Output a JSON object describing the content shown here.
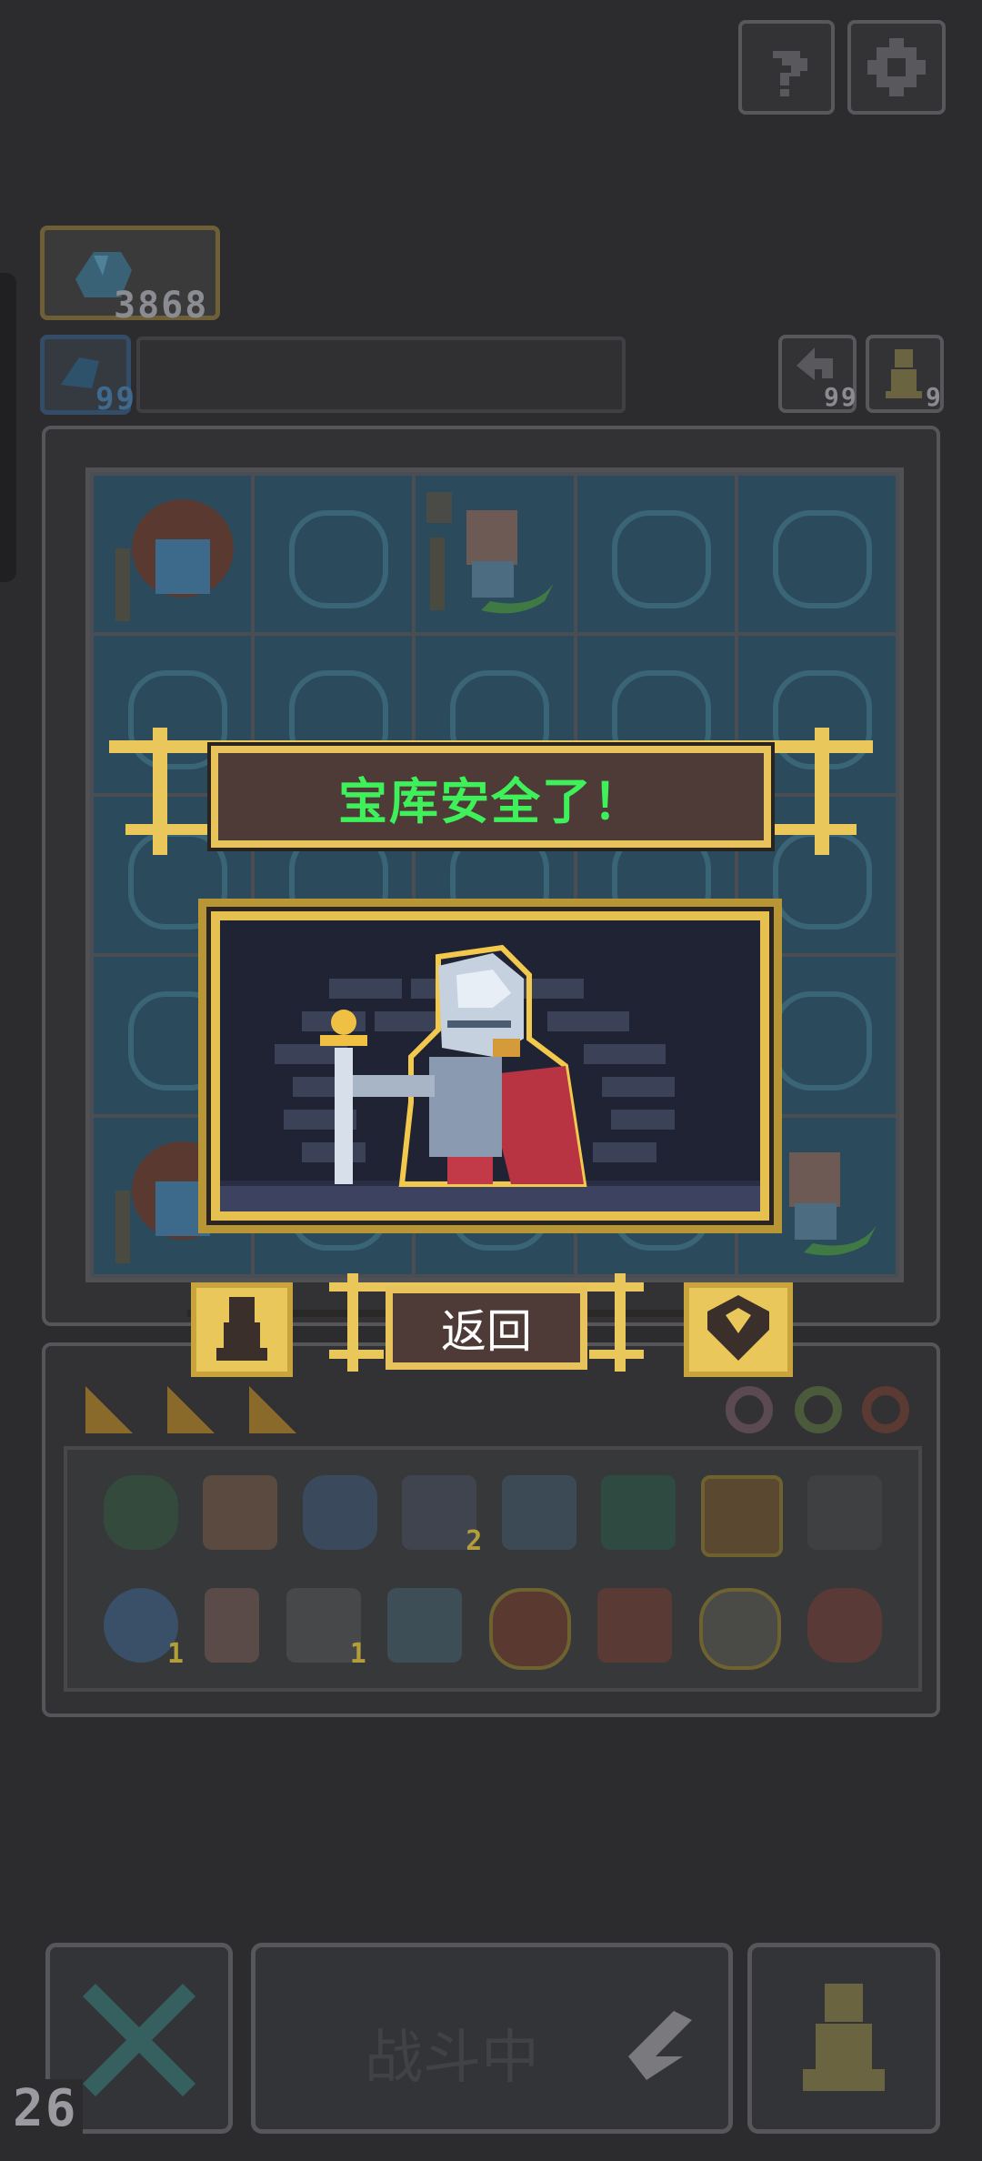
{
  "top_bar": {
    "help_icon": "question-icon",
    "settings_icon": "gear-icon"
  },
  "resources": {
    "primary_count": "3868",
    "secondary_count": "99",
    "reroll_count": "99",
    "piece_count": "9"
  },
  "popup": {
    "title": "宝库安全了！",
    "return_label": "返回",
    "title_color": "#3ef05a",
    "frame_color": "#e8c35b"
  },
  "inventory": {
    "row1_badges": [
      "",
      "",
      "",
      "2",
      "",
      "",
      "",
      ""
    ],
    "row2_badges": [
      "1",
      "",
      "1",
      "",
      "",
      "",
      "",
      ""
    ]
  },
  "bottom_bar": {
    "status_label": "战斗中",
    "turn_counter": "26"
  }
}
